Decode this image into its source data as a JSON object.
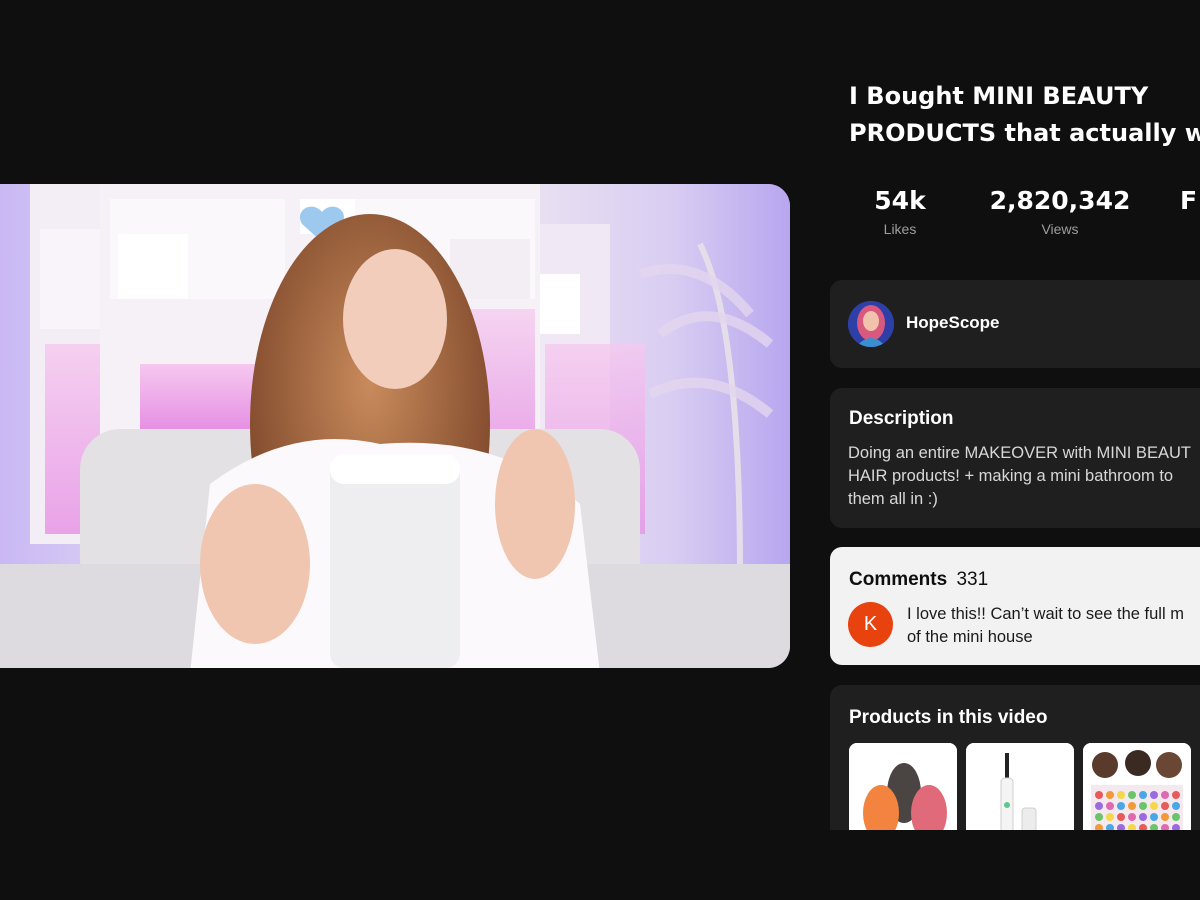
{
  "video": {
    "scene": "woman-holding-package"
  },
  "title": "I Bought MINI BEAUTY\nPRODUCTS that actually wo",
  "stats": {
    "likes": {
      "value": "54k",
      "label": "Likes"
    },
    "views": {
      "value": "2,820,342",
      "label": "Views"
    },
    "third": {
      "value": "F",
      "label": ""
    }
  },
  "channel": {
    "name": "HopeScope",
    "avatar_icon": "channel-avatar"
  },
  "description": {
    "heading": "Description",
    "text": "Doing an entire MAKEOVER with MINI BEAUT\nHAIR products! + making a mini bathroom to\nthem all in :)"
  },
  "comments": {
    "heading": "Comments",
    "count": "331",
    "first_comment": {
      "avatar_letter": "K",
      "avatar_color": "#e8420f",
      "text": "I love this!! Can’t wait to see the full m\nof the mini house"
    }
  },
  "products": {
    "heading": "Products in this video",
    "items": [
      {
        "name": "makeup-sponges"
      },
      {
        "name": "eyelash-curler"
      },
      {
        "name": "hair-accessories"
      }
    ]
  },
  "colors": {
    "background": "#0f0f0f",
    "card": "#1f1f1f",
    "comments_card": "#f2f2f2",
    "accent_avatar": "#e8420f"
  }
}
